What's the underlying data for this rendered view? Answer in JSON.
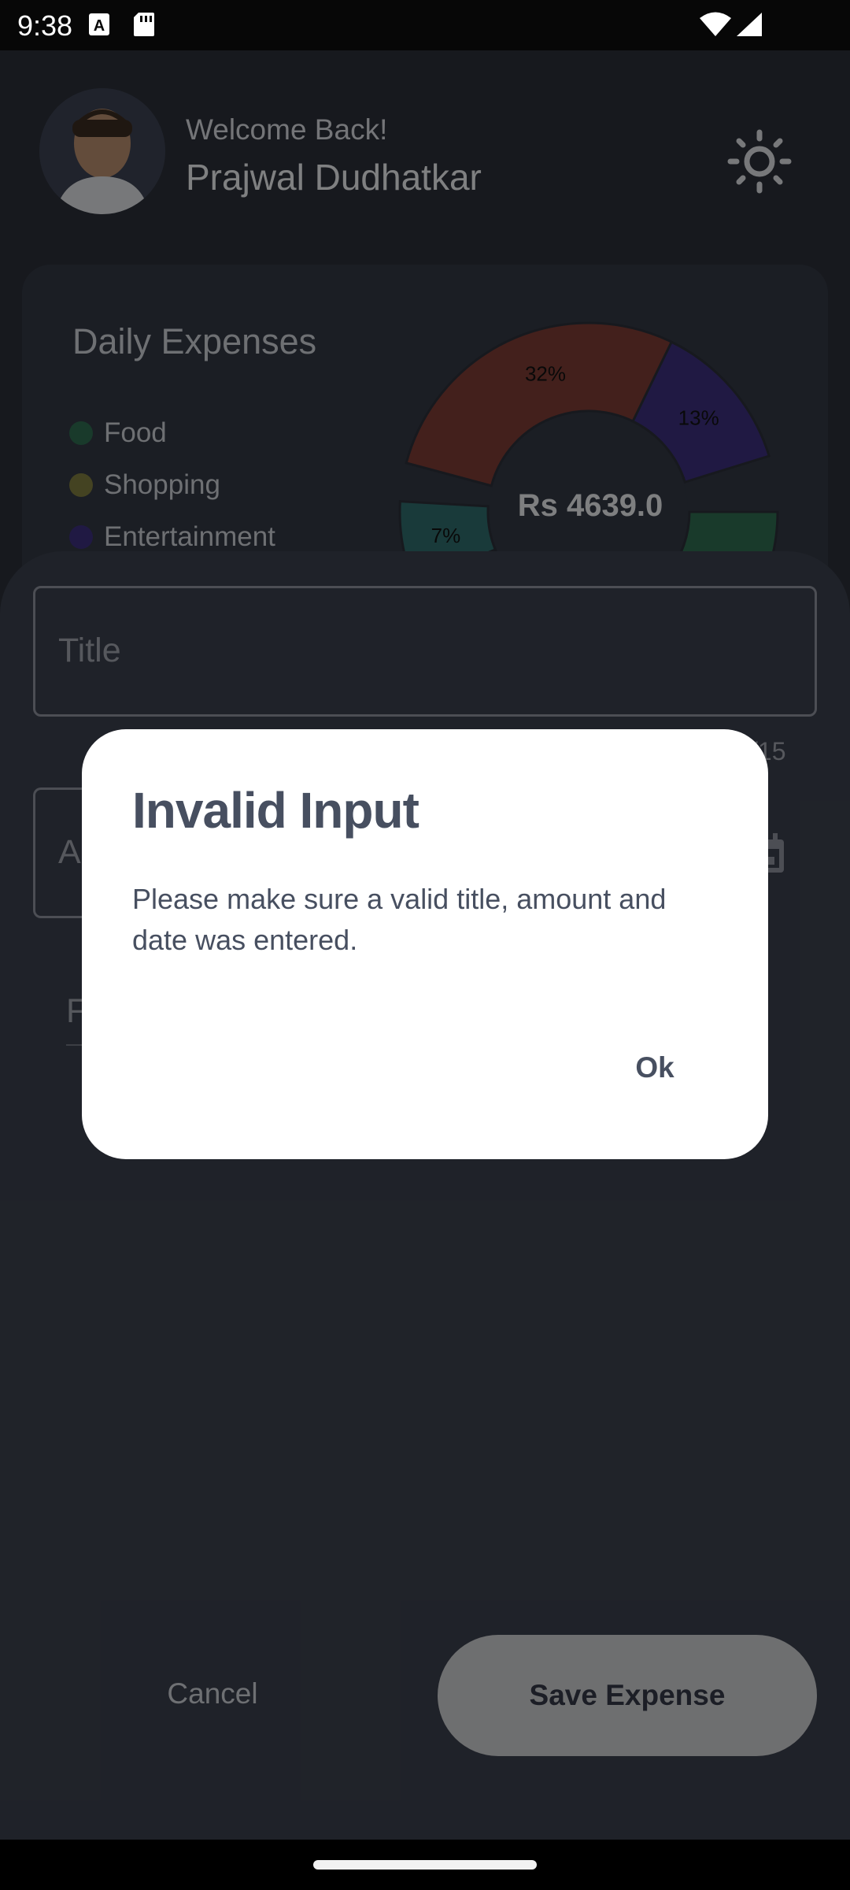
{
  "status_bar": {
    "time": "9:38",
    "icons": [
      "keyboard-a-icon",
      "sd-card-icon",
      "wifi-icon",
      "signal-icon"
    ]
  },
  "header": {
    "welcome": "Welcome Back!",
    "username": "Prajwal Dudhatkar",
    "theme_icon": "sun-icon"
  },
  "summary_card": {
    "title": "Daily Expenses",
    "legend": [
      {
        "label": "Food",
        "color": "#2f6a4f"
      },
      {
        "label": "Shopping",
        "color": "#7d7a3f"
      },
      {
        "label": "Entertainment",
        "color": "#3b2f7a"
      }
    ],
    "total": "Rs 4639.0"
  },
  "chart_data": {
    "type": "pie",
    "variant": "donut",
    "labels": [
      "32%",
      "13%",
      "7%"
    ],
    "slices": [
      {
        "value": 32,
        "color": "#7a3b34",
        "label": "32%"
      },
      {
        "value": 13,
        "color": "#3b2f7a",
        "label": "13%"
      },
      {
        "value": 7,
        "color": "#2f6a6a",
        "label": "7%"
      }
    ],
    "center_label": "Rs 4639.0"
  },
  "form": {
    "title_placeholder": "Title",
    "title_counter": "/15",
    "amount_placeholder": "A",
    "third_field_placeholder": "F",
    "cancel_label": "Cancel",
    "save_label": "Save Expense"
  },
  "dialog": {
    "title": "Invalid Input",
    "message": "Please make sure a valid title, amount and date was entered.",
    "ok_label": "Ok"
  }
}
